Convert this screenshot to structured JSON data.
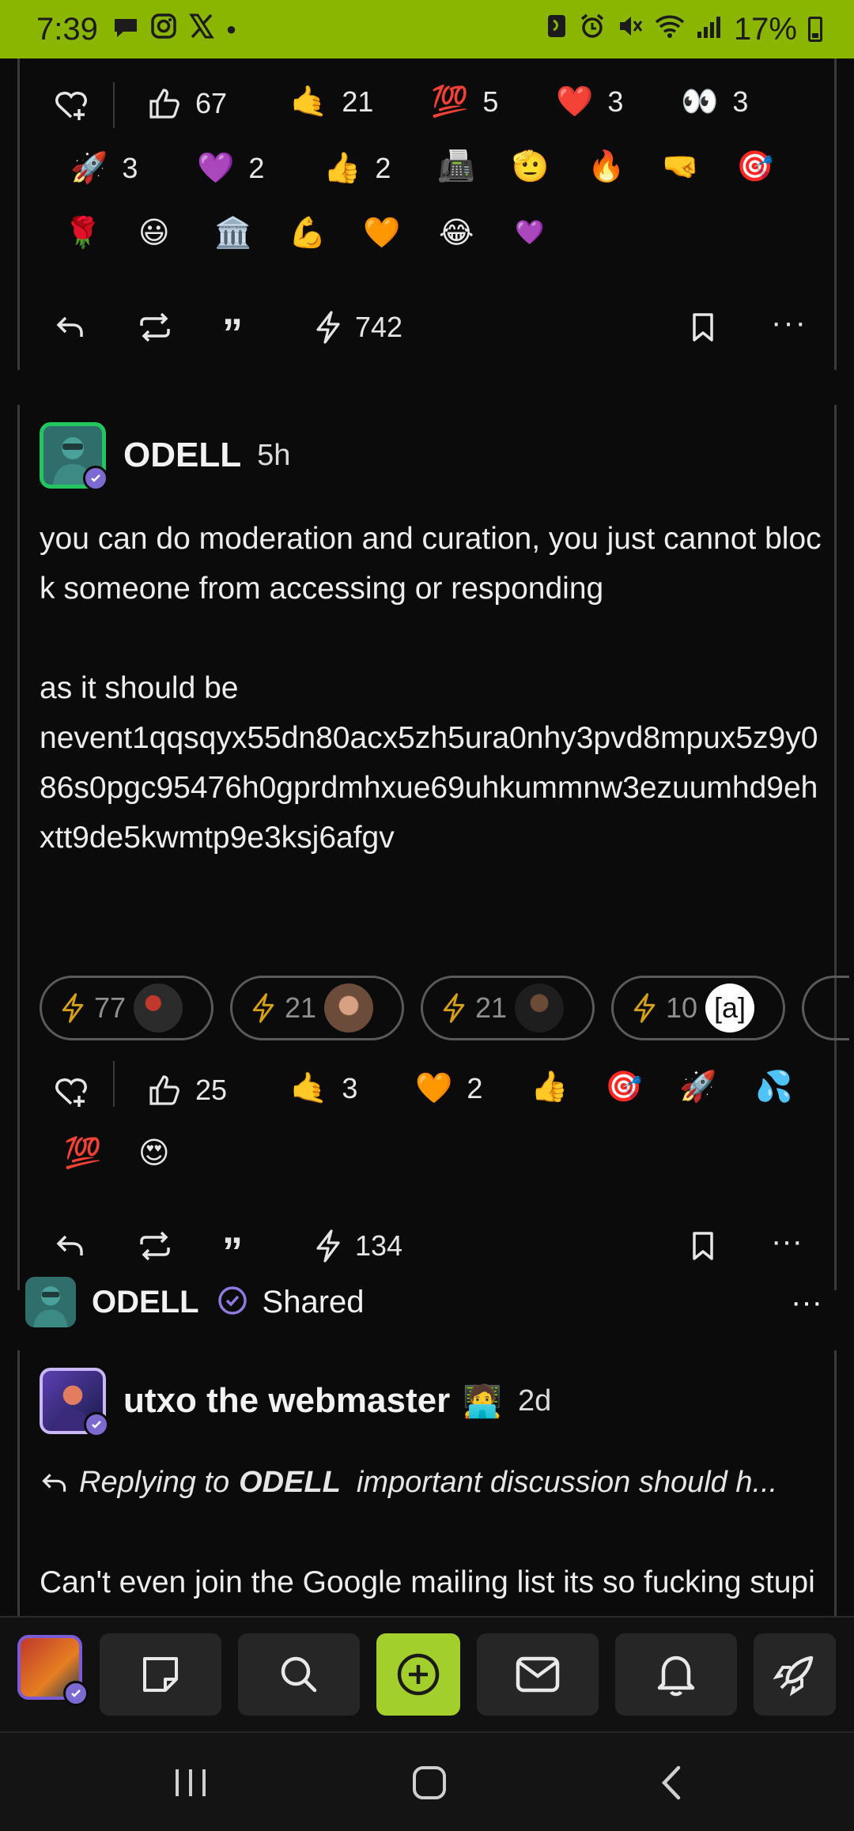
{
  "status_bar": {
    "time": "7:39",
    "battery": "17%",
    "accent_color": "#8ab500"
  },
  "post_top": {
    "reactions_row1": [
      {
        "emoji": "👍",
        "count": "67"
      },
      {
        "emoji": "🤙",
        "count": "21"
      },
      {
        "emoji": "💯",
        "count": "5"
      },
      {
        "emoji": "❤️",
        "count": "3"
      },
      {
        "emoji": "👀",
        "count": "3"
      }
    ],
    "reactions_row2": [
      {
        "emoji": "🚀",
        "count": "3"
      },
      {
        "emoji": "💜",
        "count": "2"
      },
      {
        "emoji": "👍",
        "count": "2"
      },
      {
        "emoji": "📠",
        "count": ""
      },
      {
        "emoji": "🫡",
        "count": ""
      },
      {
        "emoji": "🔥",
        "count": ""
      },
      {
        "emoji": "🤜",
        "count": ""
      },
      {
        "emoji": "🎯",
        "count": ""
      }
    ],
    "reactions_row3": [
      "🌹",
      "😃",
      "🏛️",
      "💪",
      "🧡",
      "😂",
      "💜"
    ],
    "zap_total": "742"
  },
  "post_odell": {
    "author": "ODELL",
    "time": "5h",
    "text": "you can do moderation and curation, you just cannot block someone from accessing or responding\n\nas it should be\nnevent1qqsqyx55dn80acx5zh5ura0nhy3pvd8mpux5z9y086s0pgc95476h0gprdmhxue69uhkummnw3ezuumhd9ehxtt9de5kwmtp9e3ksj6afgv",
    "zaps": [
      {
        "amount": "77"
      },
      {
        "amount": "21"
      },
      {
        "amount": "21"
      },
      {
        "amount": "10",
        "label": "[a]"
      }
    ],
    "reactions_row1": [
      {
        "emoji": "👍",
        "count": "25"
      },
      {
        "emoji": "🤙",
        "count": "3"
      },
      {
        "emoji": "🧡",
        "count": "2"
      },
      {
        "emoji": "👍",
        "count": ""
      },
      {
        "emoji": "🎯",
        "count": ""
      },
      {
        "emoji": "🚀",
        "count": ""
      },
      {
        "emoji": "💦",
        "count": ""
      }
    ],
    "reactions_row2": [
      "💯",
      "😍"
    ],
    "zap_total": "134"
  },
  "shared": {
    "by": "ODELL",
    "label": "Shared"
  },
  "post_utxo": {
    "author": "utxo the webmaster",
    "author_emoji": "🧑‍💻",
    "time": "2d",
    "reply_prefix": "Replying to",
    "reply_to": "ODELL",
    "reply_snippet": "important discussion should h...",
    "text": "Can't even join the Google mailing list its so fucking stupid and embarrassing Bitcoin works like this"
  }
}
